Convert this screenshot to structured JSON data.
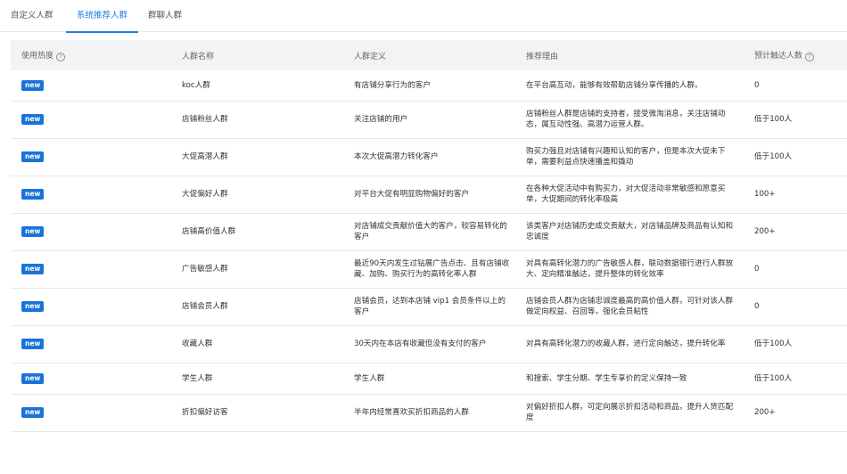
{
  "tabs": [
    {
      "label": "自定义人群",
      "active": false
    },
    {
      "label": "系统推荐人群",
      "active": true
    },
    {
      "label": "群聊人群",
      "active": false
    }
  ],
  "table": {
    "headers": {
      "usage": "使用热度",
      "name": "人群名称",
      "definition": "人群定义",
      "reason": "推荐理由",
      "reach": "预计触达人数"
    },
    "badge_label": "new",
    "rows": [
      {
        "name": "koc人群",
        "definition": "有店铺分享行为的客户",
        "reason": "在平台高互动，能够有效帮助店铺分享传播的人群。",
        "reach": "0"
      },
      {
        "name": "店铺粉丝人群",
        "definition": "关注店铺的用户",
        "reason": "店铺粉丝人群是店铺的支持者，接受微淘消息，关注店铺动态，属互动性强、高潜力运营人群。",
        "reach": "低于100人"
      },
      {
        "name": "大促高潜人群",
        "definition": "本次大促高潜力转化客户",
        "reason": "购买力强且对店铺有兴趣和认知的客户，但是本次大促未下单，需要利益点快速播盖和撬动",
        "reach": "低于100人"
      },
      {
        "name": "大促偏好人群",
        "definition": "对平台大促有明显购物偏好的客户",
        "reason": "在各种大促活动中有购买力，对大促活动非常敏感和愿意买单，大促期间的转化率极高",
        "reach": "100+"
      },
      {
        "name": "店铺高价值人群",
        "definition": "对店铺成交贡献价值大的客户，较容易转化的客户",
        "reason": "该类客户对店铺历史成交贡献大，对店铺品牌及商品有认知和忠诚度",
        "reach": "200+"
      },
      {
        "name": "广告敏感人群",
        "definition": "最近90天内发生过钻展广告点击、且有店铺收藏、加购、购买行为的高转化率人群",
        "reason": "对具有高转化潜力的广告敏感人群，联动数据银行进行人群放大、定向精准触达，提升整体的转化效率",
        "reach": "0"
      },
      {
        "name": "店铺会员人群",
        "definition": "店铺会员，达到本店铺 vip1 会员条件以上的客户",
        "reason": "店铺会员人群为店铺忠诚度最高的高价值人群，可针对该人群做定向权益、召回等，强化会员粘性",
        "reach": "0"
      },
      {
        "name": "收藏人群",
        "definition": "30天内在本店有收藏但没有支付的客户",
        "reason": "对具有高转化潜力的收藏人群，进行定向触达，提升转化率",
        "reach": "低于100人"
      },
      {
        "name": "学生人群",
        "definition": "学生人群",
        "reason": "和搜索、学生分期、学生专享价的定义保持一致",
        "reach": "低于100人"
      },
      {
        "name": "折扣偏好访客",
        "definition": "半年内经常喜欢买折扣商品的人群",
        "reason": "对偏好折扣人群，可定向展示折扣活动和商品，提升人货匹配度",
        "reach": "200+"
      }
    ]
  },
  "icons": {
    "help": "question-circle-icon"
  },
  "colors": {
    "accent": "#1f7fe0",
    "badge": "#1a73d9",
    "header_bg": "#f2f3f5"
  }
}
